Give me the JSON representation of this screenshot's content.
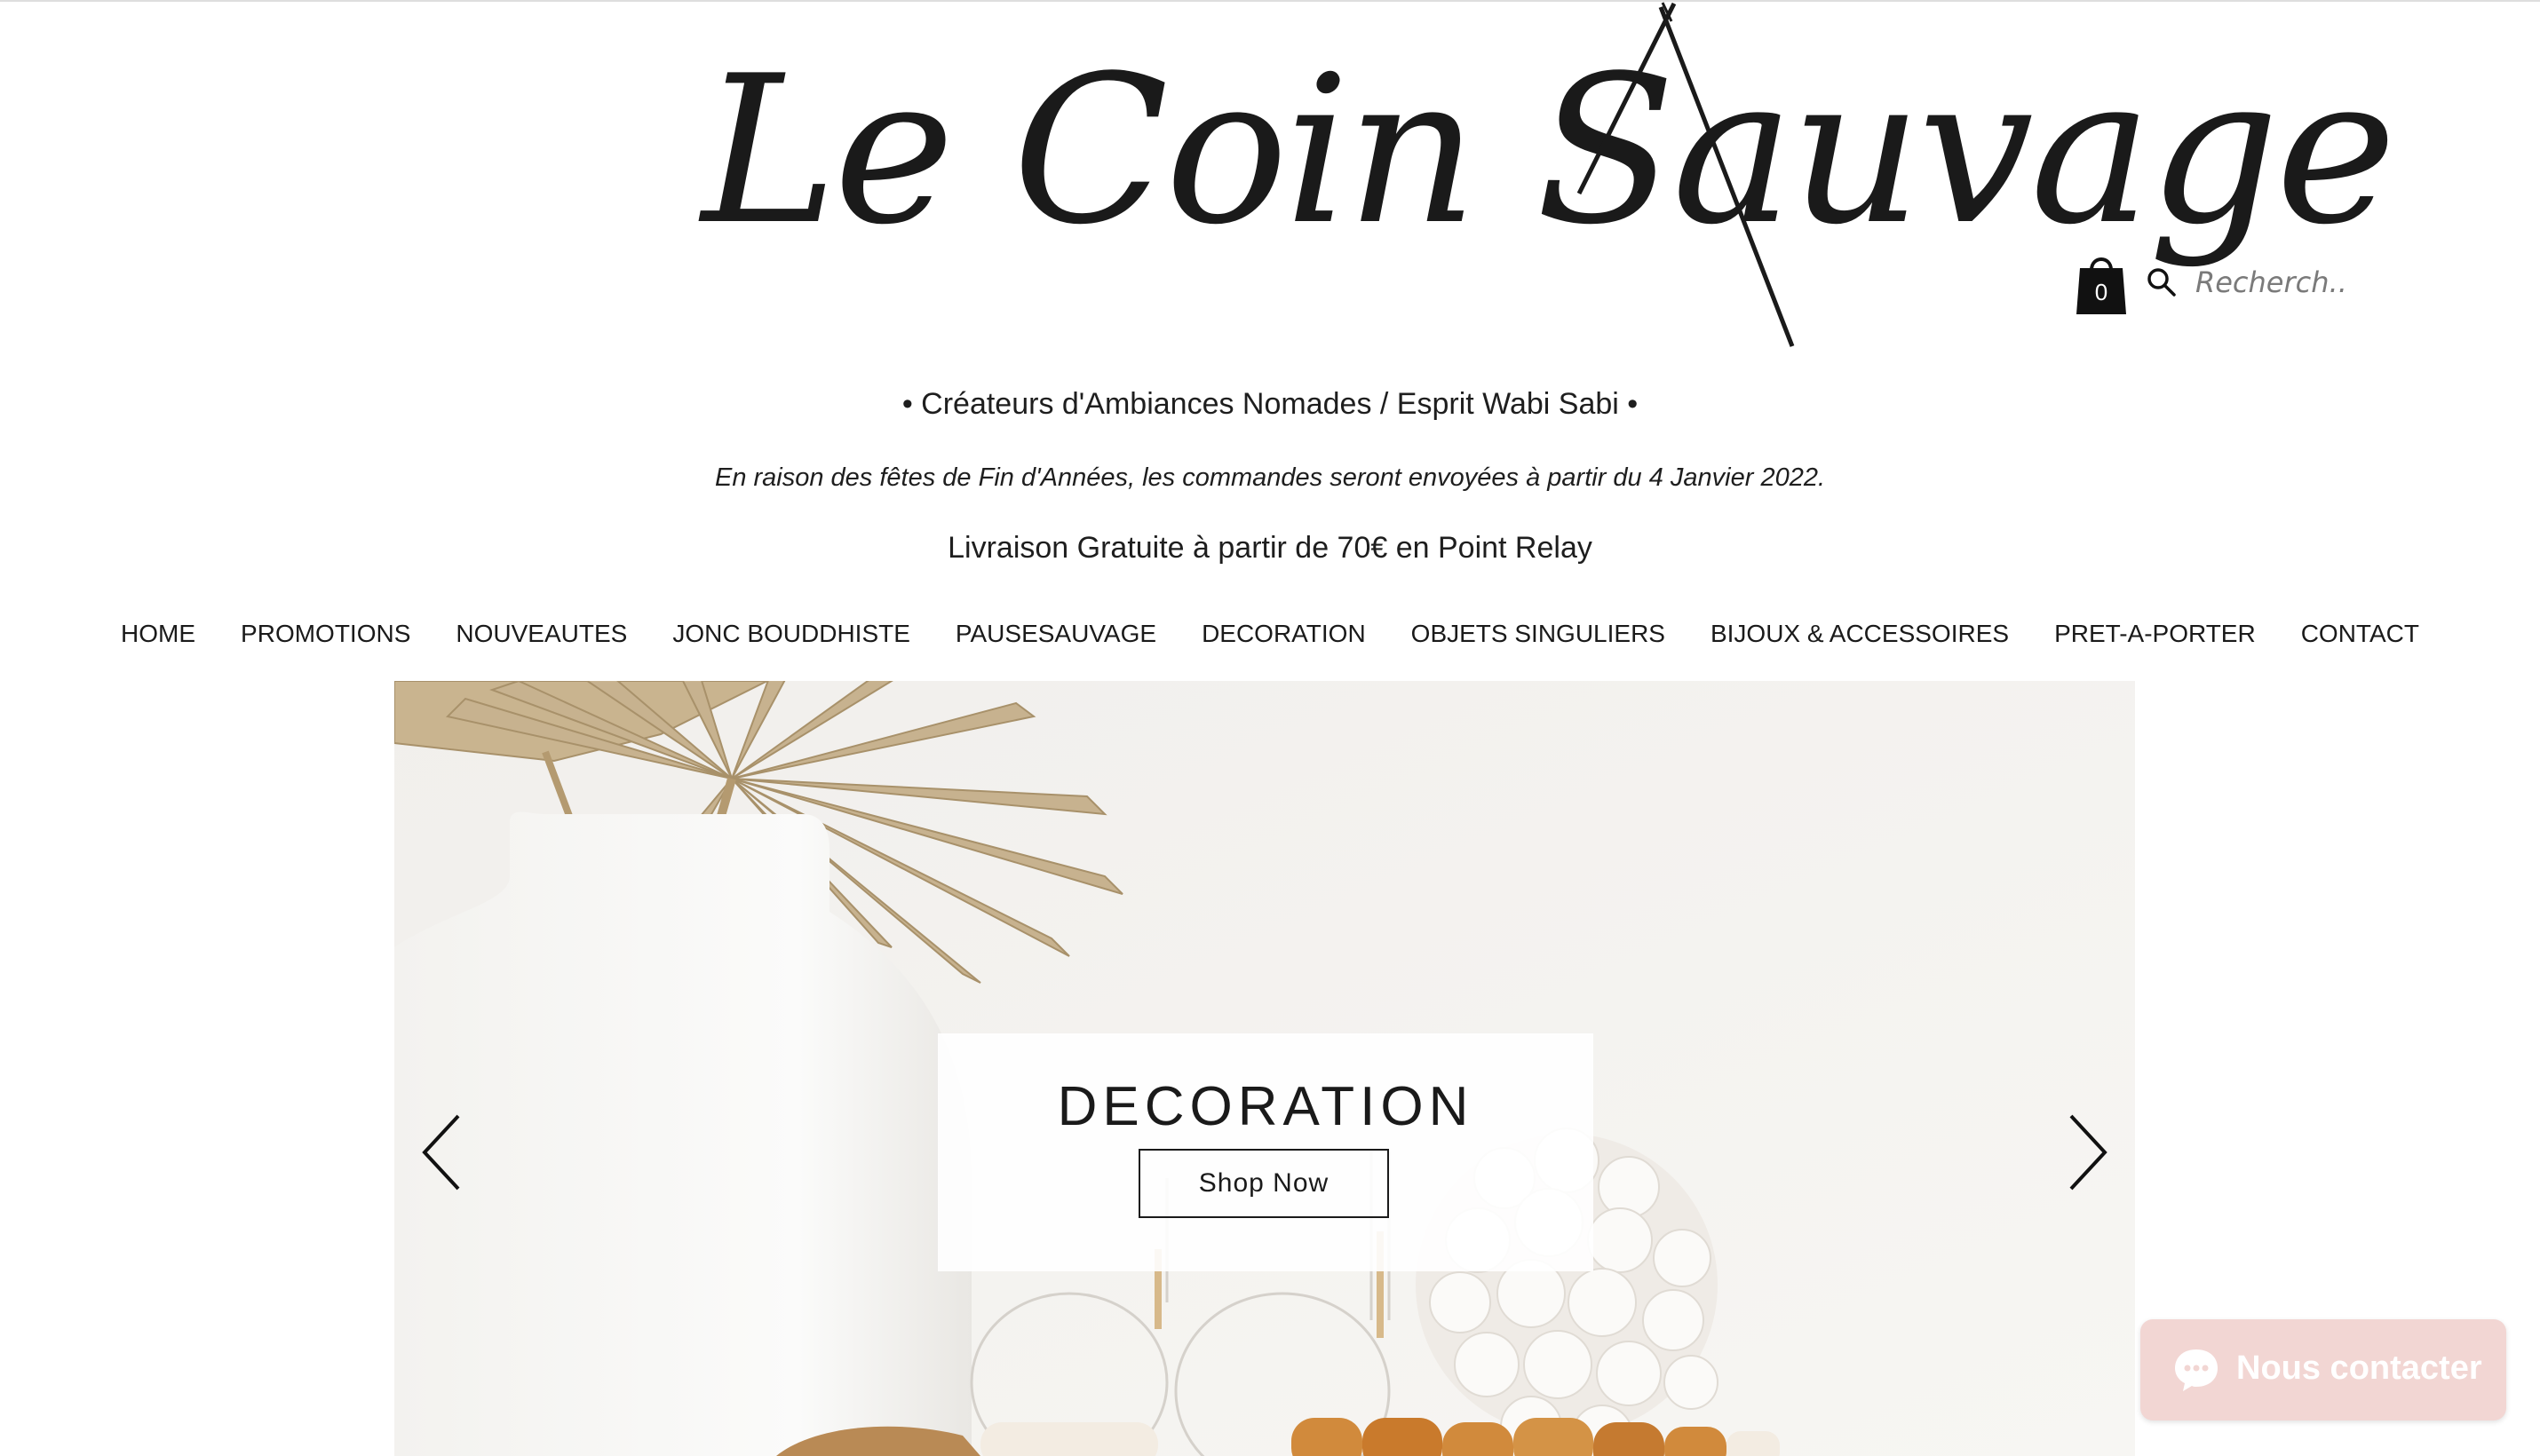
{
  "brand": {
    "logo_text": "Le Coin Sauvage"
  },
  "header": {
    "cart_count": "0",
    "search_placeholder": "Recherch..."
  },
  "tagline": "• Créateurs d'Ambiances Nomades / Esprit Wabi Sabi •",
  "notice": "En raison des fêtes de Fin d'Années, les commandes seront envoyées à partir du 4 Janvier 2022.",
  "shipping": "Livraison Gratuite à partir de 70€ en Point Relay",
  "nav": {
    "items": [
      {
        "label": "HOME"
      },
      {
        "label": "PROMOTIONS"
      },
      {
        "label": "NOUVEAUTES"
      },
      {
        "label": "JONC BOUDDHISTE"
      },
      {
        "label": "PAUSESAUVAGE"
      },
      {
        "label": "DECORATION"
      },
      {
        "label": "OBJETS SINGULIERS"
      },
      {
        "label": "BIJOUX & ACCESSOIRES"
      },
      {
        "label": "PRET-A-PORTER"
      },
      {
        "label": "CONTACT"
      }
    ]
  },
  "hero": {
    "title": "DECORATION",
    "button_label": "Shop Now"
  },
  "chat": {
    "label": "Nous contacter"
  },
  "icons": {
    "cart": "shopping-bag-icon",
    "search": "search-icon",
    "prev": "chevron-left-icon",
    "next": "chevron-right-icon",
    "chat": "chat-bubble-icon"
  },
  "colors": {
    "text": "#1a1a1a",
    "chat_bg": "#f2d6d3",
    "hero_bg": "#f4f2ef"
  }
}
